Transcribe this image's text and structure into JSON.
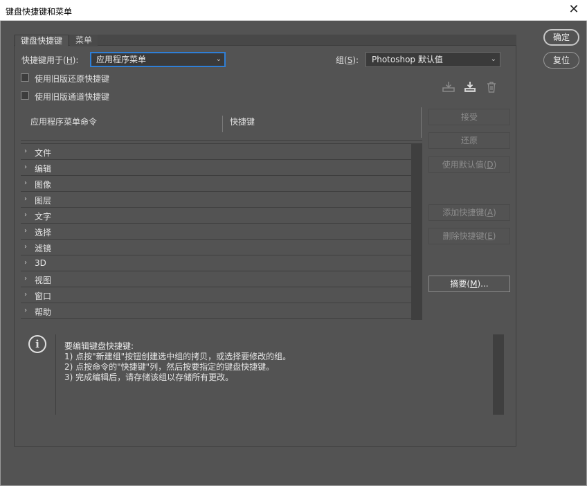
{
  "window": {
    "title": "键盘快捷键和菜单",
    "close_glyph": "✕"
  },
  "tabs": [
    {
      "label": "键盘快捷键",
      "active": true
    },
    {
      "label": "菜单",
      "active": false
    }
  ],
  "shortcuts_for": {
    "label": "快捷键用于(",
    "key": "H",
    "suffix": "):",
    "value": "应用程序菜单"
  },
  "set": {
    "label": "组(",
    "key": "S",
    "suffix": "):",
    "value": "Photoshop 默认值"
  },
  "checkboxes": [
    {
      "label": "使用旧版还原快捷键",
      "checked": false
    },
    {
      "label": "使用旧版通道快捷键",
      "checked": false
    }
  ],
  "icons": [
    "save-set-icon",
    "new-set-icon",
    "delete-set-icon"
  ],
  "columns": {
    "command": "应用程序菜单命令",
    "shortcut": "快捷键"
  },
  "menu_rows": [
    "文件",
    "编辑",
    "图像",
    "图层",
    "文字",
    "选择",
    "滤镜",
    "3D",
    "视图",
    "窗口",
    "帮助"
  ],
  "side_buttons": {
    "accept": "接受",
    "undo": "还原",
    "use_default": {
      "text": "使用默认值(",
      "key": "D",
      "suffix": ")"
    },
    "add_shortcut": {
      "text": "添加快捷键(",
      "key": "A",
      "suffix": ")"
    },
    "delete_shortcut": {
      "text": "删除快捷键(",
      "key": "E",
      "suffix": ")"
    },
    "summarize": {
      "text": "摘要(",
      "key": "M",
      "suffix": ")..."
    }
  },
  "dialog_buttons": {
    "ok": "确定",
    "reset": "复位"
  },
  "info": {
    "lines": [
      "要编辑键盘快捷键:",
      "1) 点按\"新建组\"按钮创建选中组的拷贝，或选择要修改的组。",
      "2) 点按命令的\"快捷键\"列，然后按要指定的键盘快捷键。",
      "3) 完成编辑后，请存储该组以存储所有更改。"
    ]
  },
  "colors": {
    "dialog_bg": "#535353",
    "focus": "#2f7fd6"
  }
}
